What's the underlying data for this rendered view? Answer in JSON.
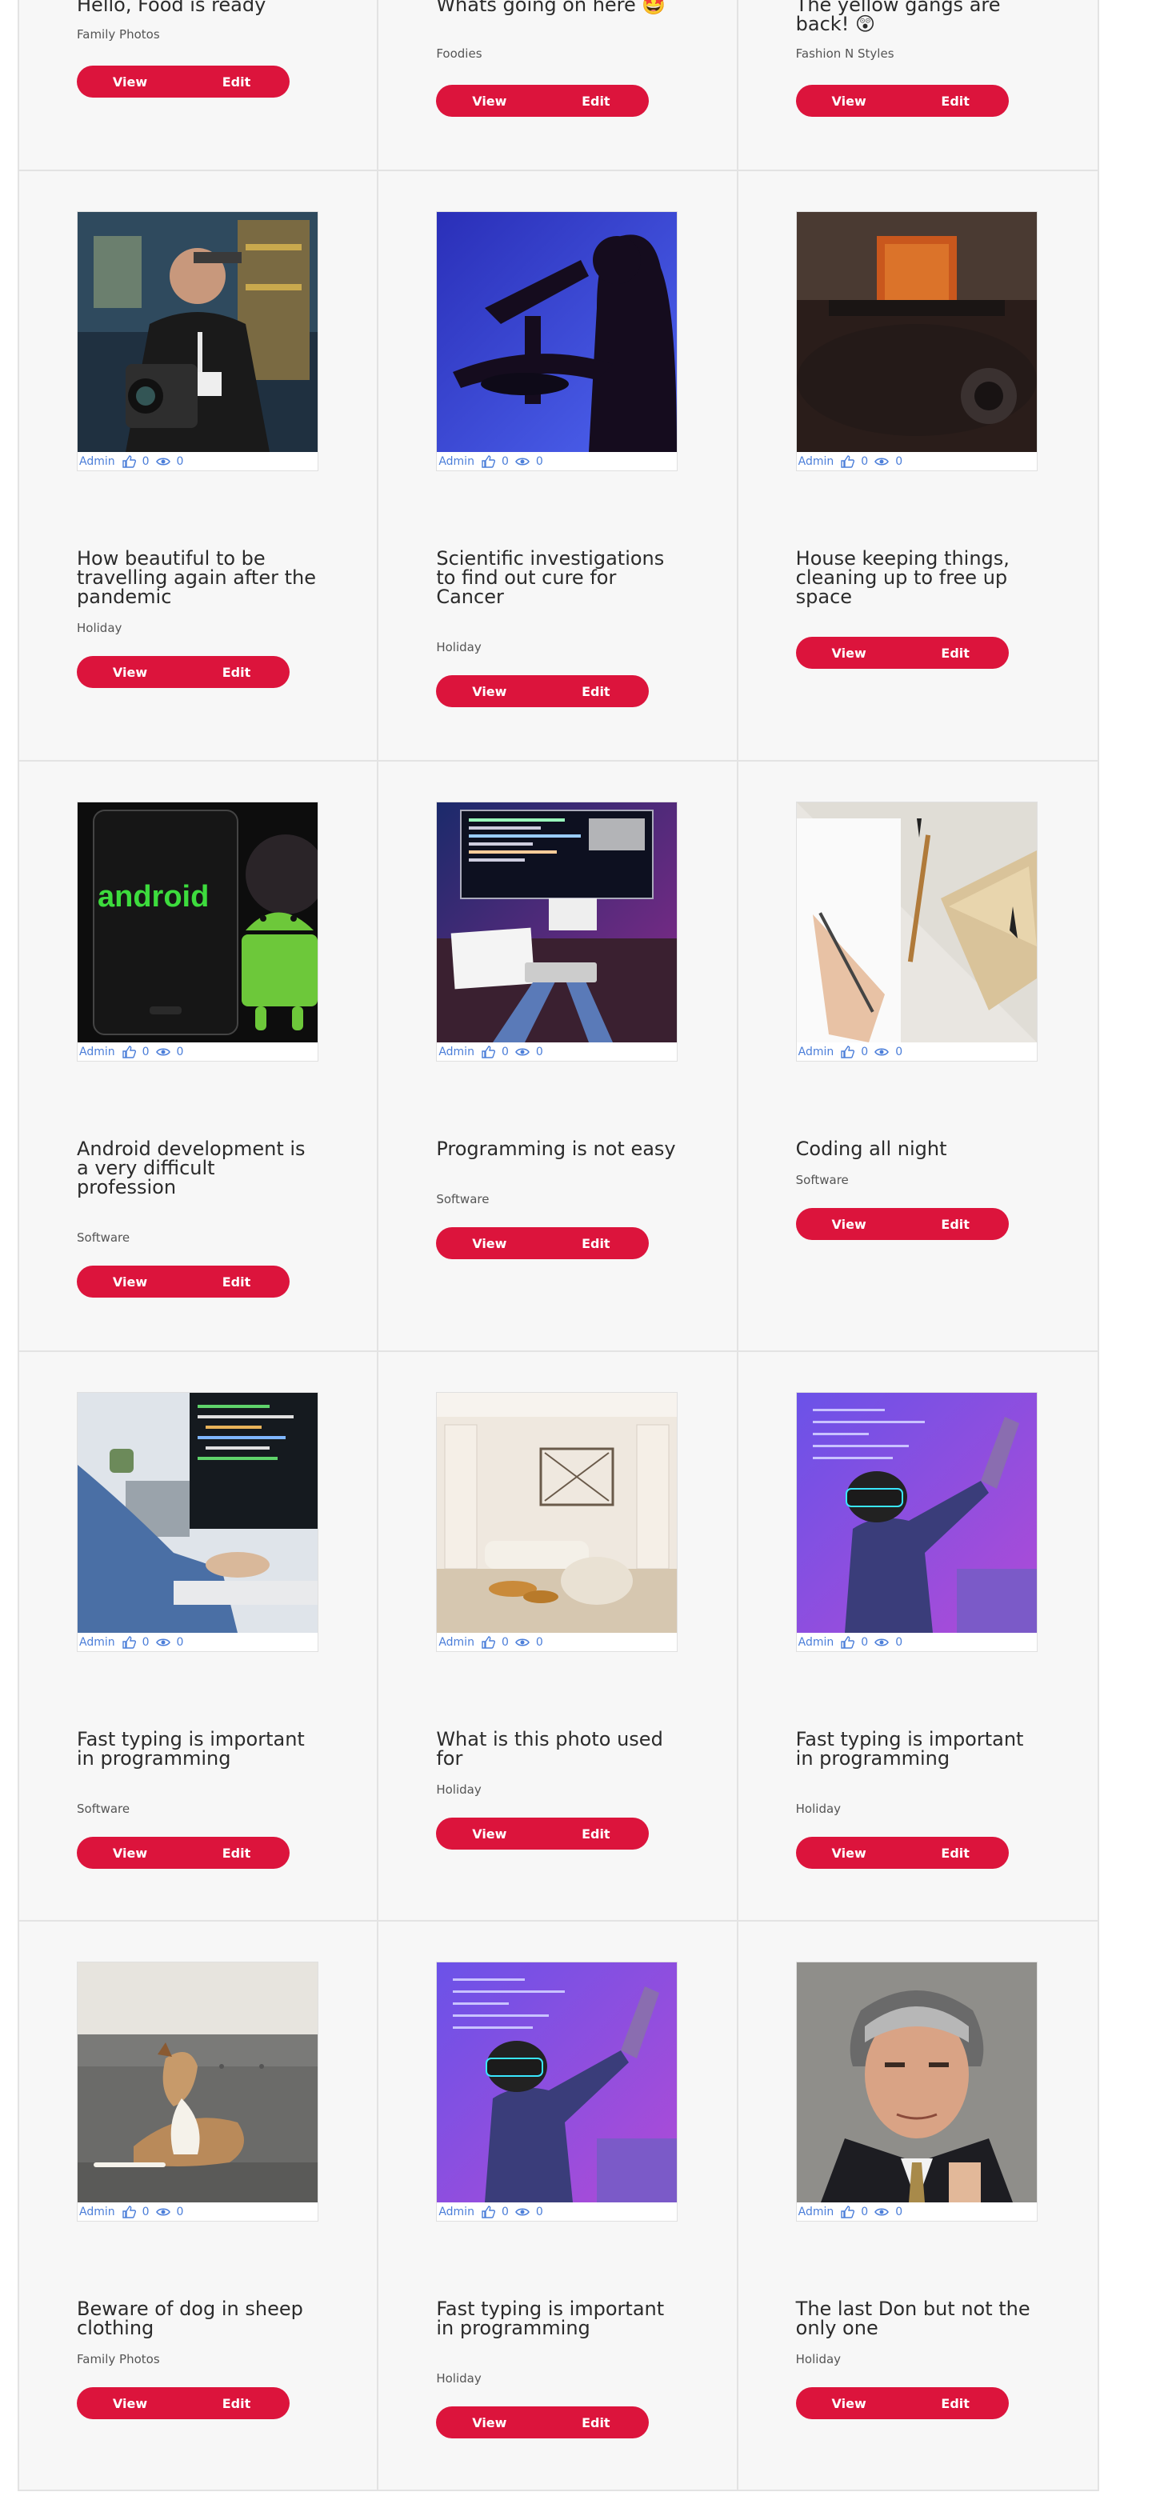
{
  "buttons": {
    "view": "View",
    "edit": "Edit"
  },
  "top_row": [
    {
      "title": "Hello, Food is ready",
      "category": "Family Photos"
    },
    {
      "title": "Whats going on here 🤩",
      "category": "Foodies"
    },
    {
      "title": "The yellow gangs are back! 😲",
      "category": "Fashion N Styles"
    }
  ],
  "cards": [
    {
      "author": "Admin",
      "likes": "0",
      "views": "0",
      "title": "How beautiful to be travelling again after the pandemic",
      "category": "Holiday"
    },
    {
      "author": "Admin",
      "likes": "0",
      "views": "0",
      "title": "Scientific investigations to find out cure for Cancer",
      "category": "Holiday"
    },
    {
      "author": "Admin",
      "likes": "0",
      "views": "0",
      "title": "House keeping things, cleaning up to free up space",
      "category": ""
    },
    {
      "author": "Admin",
      "likes": "0",
      "views": "0",
      "title": "Android development is a very difficult profession",
      "category": "Software"
    },
    {
      "author": "Admin",
      "likes": "0",
      "views": "0",
      "title": "Programming is not easy",
      "category": "Software"
    },
    {
      "author": "Admin",
      "likes": "0",
      "views": "0",
      "title": "Coding all night",
      "category": "Software"
    },
    {
      "author": "Admin",
      "likes": "0",
      "views": "0",
      "title": "Fast typing is important in programming",
      "category": "Software"
    },
    {
      "author": "Admin",
      "likes": "0",
      "views": "0",
      "title": "What is this photo used for",
      "category": "Holiday"
    },
    {
      "author": "Admin",
      "likes": "0",
      "views": "0",
      "title": "Fast typing is important in programming",
      "category": "Holiday"
    },
    {
      "author": "Admin",
      "likes": "0",
      "views": "0",
      "title": "Beware of dog in sheep clothing",
      "category": "Family Photos"
    },
    {
      "author": "Admin",
      "likes": "0",
      "views": "0",
      "title": "Fast typing is important in programming",
      "category": "Holiday"
    },
    {
      "author": "Admin",
      "likes": "0",
      "views": "0",
      "title": "The last Don but not the only one",
      "category": "Holiday"
    }
  ],
  "android_logo": "android",
  "colors": {
    "accent": "#dc143c",
    "meta": "#4b7ed9",
    "border": "#e3e3e3",
    "background": "#f7f7f7"
  },
  "icons": [
    "thumbs-up-icon",
    "eye-icon"
  ]
}
